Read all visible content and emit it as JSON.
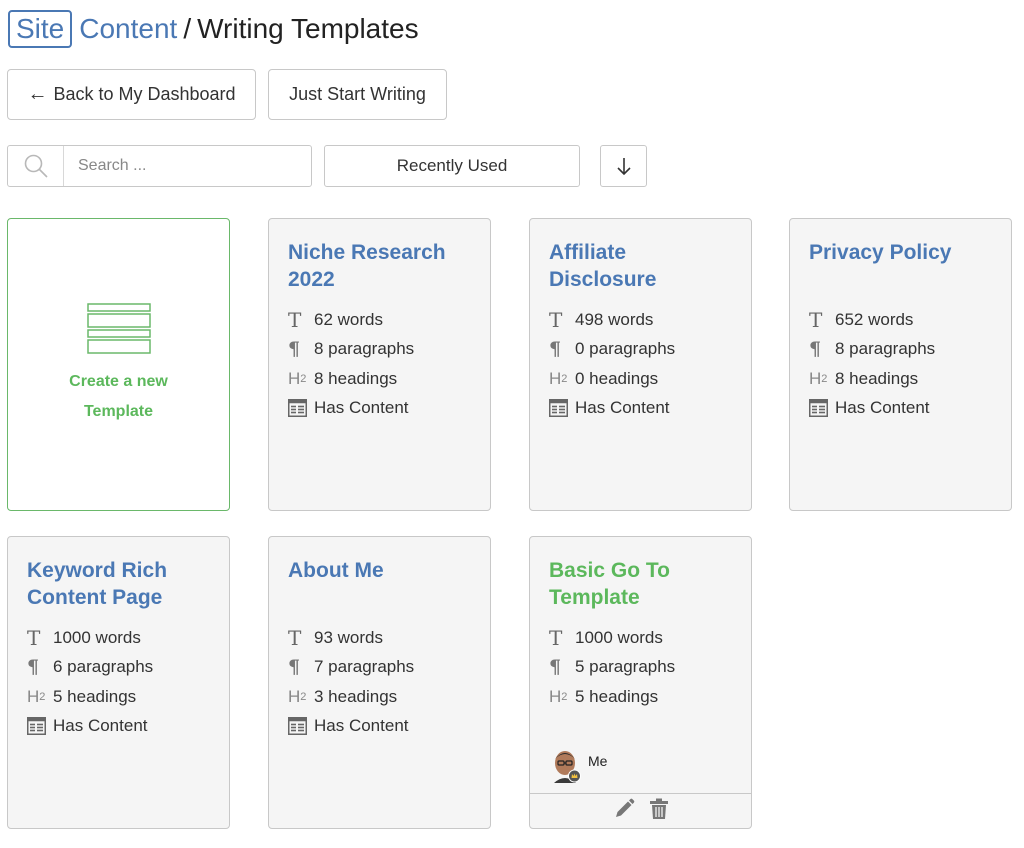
{
  "header": {
    "logo_site": "Site",
    "logo_content": "Content",
    "separator": "/",
    "title": "Writing Templates"
  },
  "actions": {
    "back_arrow": "←",
    "back_label": "Back to My Dashboard",
    "start_label": "Just Start Writing"
  },
  "toolbar": {
    "search_placeholder": "Search ...",
    "search_icon": "search-icon",
    "sort_value": "Recently Used",
    "sort_direction_icon": "arrow-down-icon"
  },
  "new_template": {
    "line1": "Create a new",
    "line2": "Template",
    "icon": "template-icon"
  },
  "stat_icons": {
    "words": "T",
    "paragraphs": "¶",
    "headings": "H",
    "headings_sub": "2"
  },
  "templates": [
    {
      "title": "Niche Research 2022",
      "words": "62 words",
      "paragraphs": "8 paragraphs",
      "headings": "8 headings",
      "content": "Has Content"
    },
    {
      "title": "Affiliate Disclosure",
      "words": "498 words",
      "paragraphs": "0 paragraphs",
      "headings": "0 headings",
      "content": "Has Content"
    },
    {
      "title": "Privacy Policy",
      "words": "652 words",
      "paragraphs": "8 paragraphs",
      "headings": "8 headings",
      "content": "Has Content"
    },
    {
      "title": "Keyword Rich Content Page",
      "words": "1000 words",
      "paragraphs": "6 paragraphs",
      "headings": "5 headings",
      "content": "Has Content"
    },
    {
      "title": "About Me",
      "words": "93 words",
      "paragraphs": "7 paragraphs",
      "headings": "3 headings",
      "content": "Has Content"
    },
    {
      "title": "Basic Go To Template",
      "words": "1000 words",
      "paragraphs": "5 paragraphs",
      "headings": "5 headings",
      "owner": "Me",
      "title_color": "#5cb85c"
    }
  ],
  "colors": {
    "brand_blue": "#4a78b4",
    "green": "#5cb85c"
  }
}
